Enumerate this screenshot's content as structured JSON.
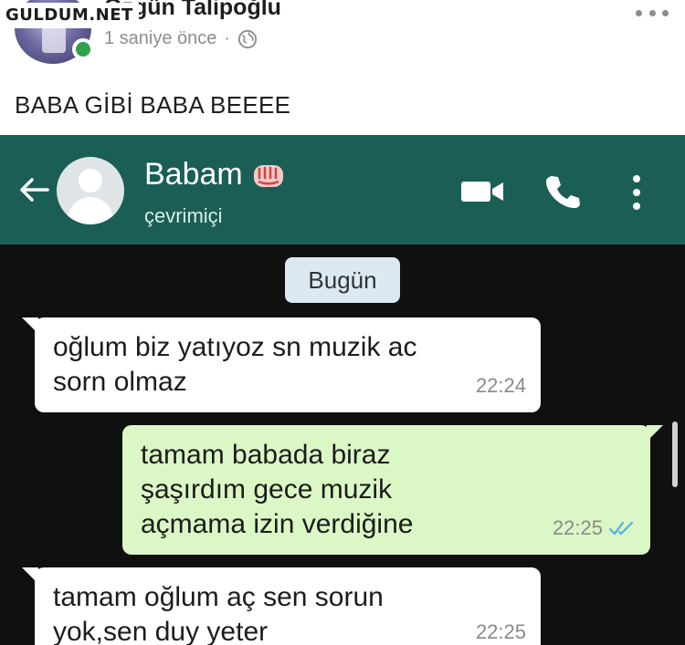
{
  "post": {
    "watermark": "GULDUM.NET",
    "author": "Özgün Talipoğlu",
    "time": "1 saniye önce",
    "separator": "·",
    "text": "BABA GİBİ BABA BEEEE"
  },
  "chat": {
    "contact_name": "Babam",
    "contact_status": "çevrimiçi",
    "date_label": "Bugün",
    "messages": [
      {
        "direction": "in",
        "text": "oğlum biz yatıyoz sn muzik ac sorn olmaz",
        "time": "22:24"
      },
      {
        "direction": "out",
        "text": "tamam babada biraz şaşırdım gece muzik açmama izin verdiğine",
        "time": "22:25"
      },
      {
        "direction": "in",
        "text": "tamam oğlum aç sen sorun yok,sen duy yeter",
        "time": "22:25"
      }
    ]
  },
  "colors": {
    "header_teal": "#1b5e55",
    "outgoing_bubble": "#dbf7c5",
    "read_ticks": "#4fb3e8",
    "online": "#31a24c"
  },
  "icons": [
    "globe-icon",
    "more-icon",
    "back-arrow-icon",
    "fist-emoji-icon",
    "video-call-icon",
    "phone-call-icon",
    "menu-icon",
    "double-check-icon"
  ]
}
